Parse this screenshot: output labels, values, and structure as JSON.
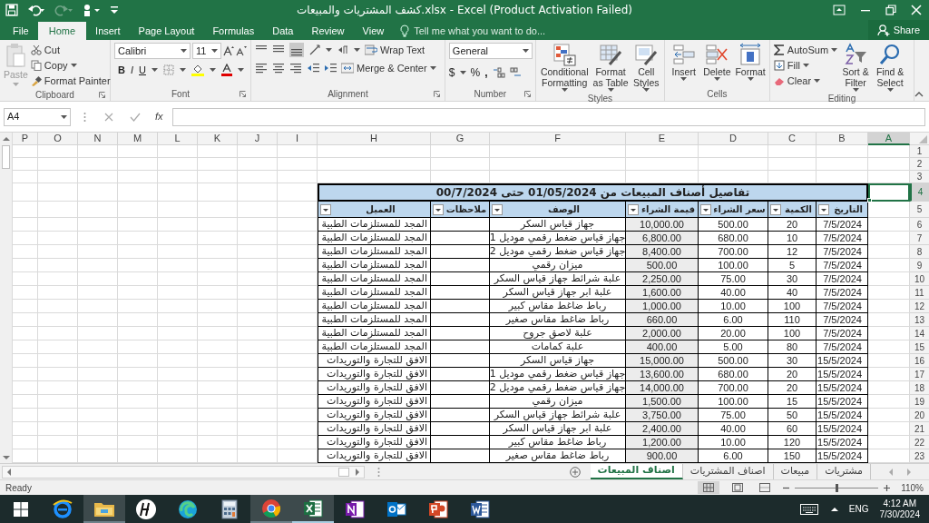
{
  "window": {
    "title": "كشف المشتريات والمبيعات.xlsx - Excel (Product Activation Failed)"
  },
  "tabs": {
    "file": {
      "label": "File",
      "selected": false
    },
    "home": {
      "label": "Home",
      "selected": true
    },
    "insert": {
      "label": "Insert",
      "selected": false
    },
    "page_layout": {
      "label": "Page Layout",
      "selected": false
    },
    "formulas": {
      "label": "Formulas",
      "selected": false
    },
    "data": {
      "label": "Data",
      "selected": false
    },
    "review": {
      "label": "Review",
      "selected": false
    },
    "view": {
      "label": "View",
      "selected": false
    }
  },
  "tell_me": {
    "placeholder": "Tell me what you want to do..."
  },
  "share": "Share",
  "ribbon": {
    "clipboard": {
      "label": "Clipboard",
      "paste": "Paste",
      "cut": "Cut",
      "copy": "Copy",
      "format_painter": "Format Painter"
    },
    "font": {
      "label": "Font",
      "name": "Calibri",
      "size": "11",
      "bold": "B",
      "italic": "I",
      "underline": "U"
    },
    "alignment": {
      "label": "Alignment",
      "wrap_text": "Wrap Text",
      "merge_center": "Merge & Center"
    },
    "number": {
      "label": "Number",
      "format": "General",
      "currency": "$",
      "percent": "%",
      "comma": ","
    },
    "styles": {
      "label": "Styles",
      "conditional_formatting": "Conditional Formatting",
      "format_as_table": "Format as Table",
      "cell_styles": "Cell Styles"
    },
    "cells": {
      "label": "Cells",
      "insert": "Insert",
      "delete": "Delete",
      "format": "Format"
    },
    "editing": {
      "label": "Editing",
      "autosum": "AutoSum",
      "fill": "Fill",
      "clear": "Clear",
      "sort_filter": "Sort & Filter",
      "find_select": "Find & Select"
    }
  },
  "formula_bar": {
    "name_box": "A4",
    "function_label": "fx"
  },
  "sheet": {
    "columns": [
      "A",
      "B",
      "C",
      "D",
      "E",
      "F",
      "G",
      "H",
      "I",
      "J",
      "K",
      "L",
      "M",
      "N",
      "O",
      "P"
    ],
    "empty_rows": [
      "1",
      "2",
      "3"
    ],
    "title_row": {
      "number": "4",
      "text": "تفاصيل أصناف المبيعات من 01/05/2024 حتى 00/7/2024"
    },
    "header_row": {
      "number": "5",
      "headers": [
        "التاريخ",
        "الكمية",
        "سعر الشراء",
        "قيمة الشراء",
        "الوصف",
        "ملاحظات",
        "العميل"
      ]
    },
    "rows": [
      {
        "number": "6",
        "date": "7/5/2024",
        "quantity": "20",
        "price": "500.00",
        "value": "10,000.00",
        "description": "جهاز قياس السكر",
        "client": "المجد للمستلزمات الطبية"
      },
      {
        "number": "7",
        "date": "7/5/2024",
        "quantity": "10",
        "price": "680.00",
        "value": "6,800.00",
        "description": "جهاز قياس ضغط رقمي موديل 1",
        "client": "المجد للمستلزمات الطبية"
      },
      {
        "number": "8",
        "date": "7/5/2024",
        "quantity": "12",
        "price": "700.00",
        "value": "8,400.00",
        "description": "جهاز قياس ضغط رقمي موديل 2",
        "client": "المجد للمستلزمات الطبية"
      },
      {
        "number": "9",
        "date": "7/5/2024",
        "quantity": "5",
        "price": "100.00",
        "value": "500.00",
        "description": "ميزان رقمي",
        "client": "المجد للمستلزمات الطبية"
      },
      {
        "number": "10",
        "date": "7/5/2024",
        "quantity": "30",
        "price": "75.00",
        "value": "2,250.00",
        "description": "علبة شرائط جهاز قياس السكر",
        "client": "المجد للمستلزمات الطبية"
      },
      {
        "number": "11",
        "date": "7/5/2024",
        "quantity": "40",
        "price": "40.00",
        "value": "1,600.00",
        "description": "علبة ابر جهاز قياس السكر",
        "client": "المجد للمستلزمات الطبية"
      },
      {
        "number": "12",
        "date": "7/5/2024",
        "quantity": "100",
        "price": "10.00",
        "value": "1,000.00",
        "description": "رباط ضاغط مقاس كبير",
        "client": "المجد للمستلزمات الطبية"
      },
      {
        "number": "13",
        "date": "7/5/2024",
        "quantity": "110",
        "price": "6.00",
        "value": "660.00",
        "description": "رباط ضاغط مقاس صغير",
        "client": "المجد للمستلزمات الطبية"
      },
      {
        "number": "14",
        "date": "7/5/2024",
        "quantity": "100",
        "price": "20.00",
        "value": "2,000.00",
        "description": "علبة لاصق جروح",
        "client": "المجد للمستلزمات الطبية"
      },
      {
        "number": "15",
        "date": "7/5/2024",
        "quantity": "80",
        "price": "5.00",
        "value": "400.00",
        "description": "علبة كمامات",
        "client": "المجد للمستلزمات الطبية"
      },
      {
        "number": "16",
        "date": "15/5/2024",
        "quantity": "30",
        "price": "500.00",
        "value": "15,000.00",
        "description": "جهاز قياس السكر",
        "client": "الافق للتجارة والتوريدات"
      },
      {
        "number": "17",
        "date": "15/5/2024",
        "quantity": "20",
        "price": "680.00",
        "value": "13,600.00",
        "description": "جهاز قياس ضغط رقمي موديل 1",
        "client": "الافق للتجارة والتوريدات"
      },
      {
        "number": "18",
        "date": "15/5/2024",
        "quantity": "20",
        "price": "700.00",
        "value": "14,000.00",
        "description": "جهاز قياس ضغط رقمي موديل 2",
        "client": "الافق للتجارة والتوريدات"
      },
      {
        "number": "19",
        "date": "15/5/2024",
        "quantity": "15",
        "price": "100.00",
        "value": "1,500.00",
        "description": "ميزان رقمي",
        "client": "الافق للتجارة والتوريدات"
      },
      {
        "number": "20",
        "date": "15/5/2024",
        "quantity": "50",
        "price": "75.00",
        "value": "3,750.00",
        "description": "علبة شرائط جهاز قياس السكر",
        "client": "الافق للتجارة والتوريدات"
      },
      {
        "number": "21",
        "date": "15/5/2024",
        "quantity": "60",
        "price": "40.00",
        "value": "2,400.00",
        "description": "علبة ابر جهاز قياس السكر",
        "client": "الافق للتجارة والتوريدات"
      },
      {
        "number": "22",
        "date": "15/5/2024",
        "quantity": "120",
        "price": "10.00",
        "value": "1,200.00",
        "description": "رباط ضاغط مقاس كبير",
        "client": "الافق للتجارة والتوريدات"
      },
      {
        "number": "23",
        "date": "15/5/2024",
        "quantity": "150",
        "price": "6.00",
        "value": "900.00",
        "description": "رباط ضاغط مقاس صغير",
        "client": "الافق للتجارة والتوريدات"
      }
    ]
  },
  "sheets": [
    {
      "label": "مشتريات",
      "selected": false
    },
    {
      "label": "مبيعات",
      "selected": false
    },
    {
      "label": "اصناف المشتريات",
      "selected": false
    },
    {
      "label": "اصناف المبيعات",
      "selected": true
    }
  ],
  "status_bar": {
    "text": "Ready",
    "zoom": "110%",
    "zoom_slider": {
      "level": 0.5
    }
  },
  "taskbar": {
    "apps": [
      {
        "kind": "browser",
        "open": false,
        "active": false
      },
      {
        "kind": "folder",
        "open": true,
        "active": false
      },
      {
        "kind": "vendor",
        "open": false,
        "active": false
      },
      {
        "kind": "swirl",
        "open": false,
        "active": false
      },
      {
        "kind": "calculator",
        "open": false,
        "active": false
      },
      {
        "kind": "chrome",
        "open": true,
        "active": false
      },
      {
        "kind": "spreadsheet",
        "open": true,
        "active": true
      },
      {
        "kind": "notebook",
        "open": false,
        "active": false
      },
      {
        "kind": "mail",
        "open": false,
        "active": false
      },
      {
        "kind": "slides",
        "open": false,
        "active": false
      },
      {
        "kind": "document",
        "open": false,
        "active": false
      }
    ],
    "language": "ENG",
    "time": "4:12 AM",
    "date": "7/30/2024"
  }
}
